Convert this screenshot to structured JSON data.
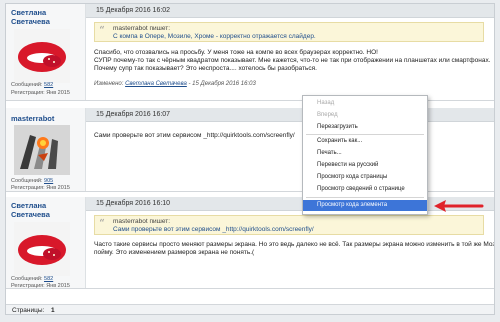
{
  "posts": [
    {
      "user": {
        "name_line1": "Светлана",
        "name_line2": "Светачева",
        "posts_label": "Сообщений:",
        "posts": "582",
        "reg_label": "Регистрация:",
        "reg": "Янв 2015"
      },
      "date": "15 Декабря 2016 16:02",
      "quote": {
        "author": "masterrabot пишет:",
        "text": "С компа в Опере, Мозиле, Хроме - корректно отражается слайдер."
      },
      "lines": [
        "Спасибо, что отозвались на просьбу. У меня тоже на компе во всех браузерах корректно. НО!",
        "СУПР почему-то так с чёрным квадратом показывает. Мне кажется, что-то не так при отображении на планшетах или смартфонах.",
        "Почему супр так показывает? Это неспроста.... хотелось бы разобраться."
      ],
      "edited": {
        "label": "Изменено:",
        "user": "Светлана Светачева",
        "date": "- 15 Декабря 2016 16:03"
      }
    },
    {
      "user": {
        "name_line1": "masterrabot",
        "posts_label": "Сообщений:",
        "posts": "905",
        "reg_label": "Регистрация:",
        "reg": "Янв 2015"
      },
      "date": "15 Декабря 2016 16:07",
      "lines": [
        "Сами проверьте вот этим сервисом _http://quirktools.com/screenfly/"
      ]
    },
    {
      "user": {
        "name_line1": "Светлана",
        "name_line2": "Светачева",
        "posts_label": "Сообщений:",
        "posts": "582",
        "reg_label": "Регистрация:",
        "reg": "Янв 2015"
      },
      "date": "15 Декабря 2016 16:10",
      "quote": {
        "author": "masterrabot пишет:",
        "text": "Сами проверьте вот этим сервисом _http://quirktools.com/screenfly/"
      },
      "lines": [
        "Часто такие сервисы просто меняют размеры экрана. Но это ведь далеко не всё. Так размеры экрана можно изменить в той же Мозилле. Я",
        "пойму. Это изменением размеров экрана не понять.("
      ]
    }
  ],
  "footer": {
    "pages_label": "Страницы:",
    "page": "1"
  },
  "context_menu": {
    "items": [
      {
        "label": "Назад",
        "disabled": true
      },
      {
        "label": "Вперед",
        "disabled": true
      },
      {
        "label": "Перезагрузить"
      },
      {
        "label": "Сохранить как..."
      },
      {
        "label": "Печать..."
      },
      {
        "label": "Перевести на русский"
      },
      {
        "label": "Просмотр кода страницы"
      },
      {
        "label": "Просмотр  сведений о странице"
      },
      {
        "label": "Просмотр кода элемента",
        "selected": true
      }
    ]
  },
  "colors": {
    "selection": "#3d75d8",
    "arrow": "#e0232a",
    "link": "#1f4e8c",
    "quote_bg": "#fbf6d9"
  }
}
